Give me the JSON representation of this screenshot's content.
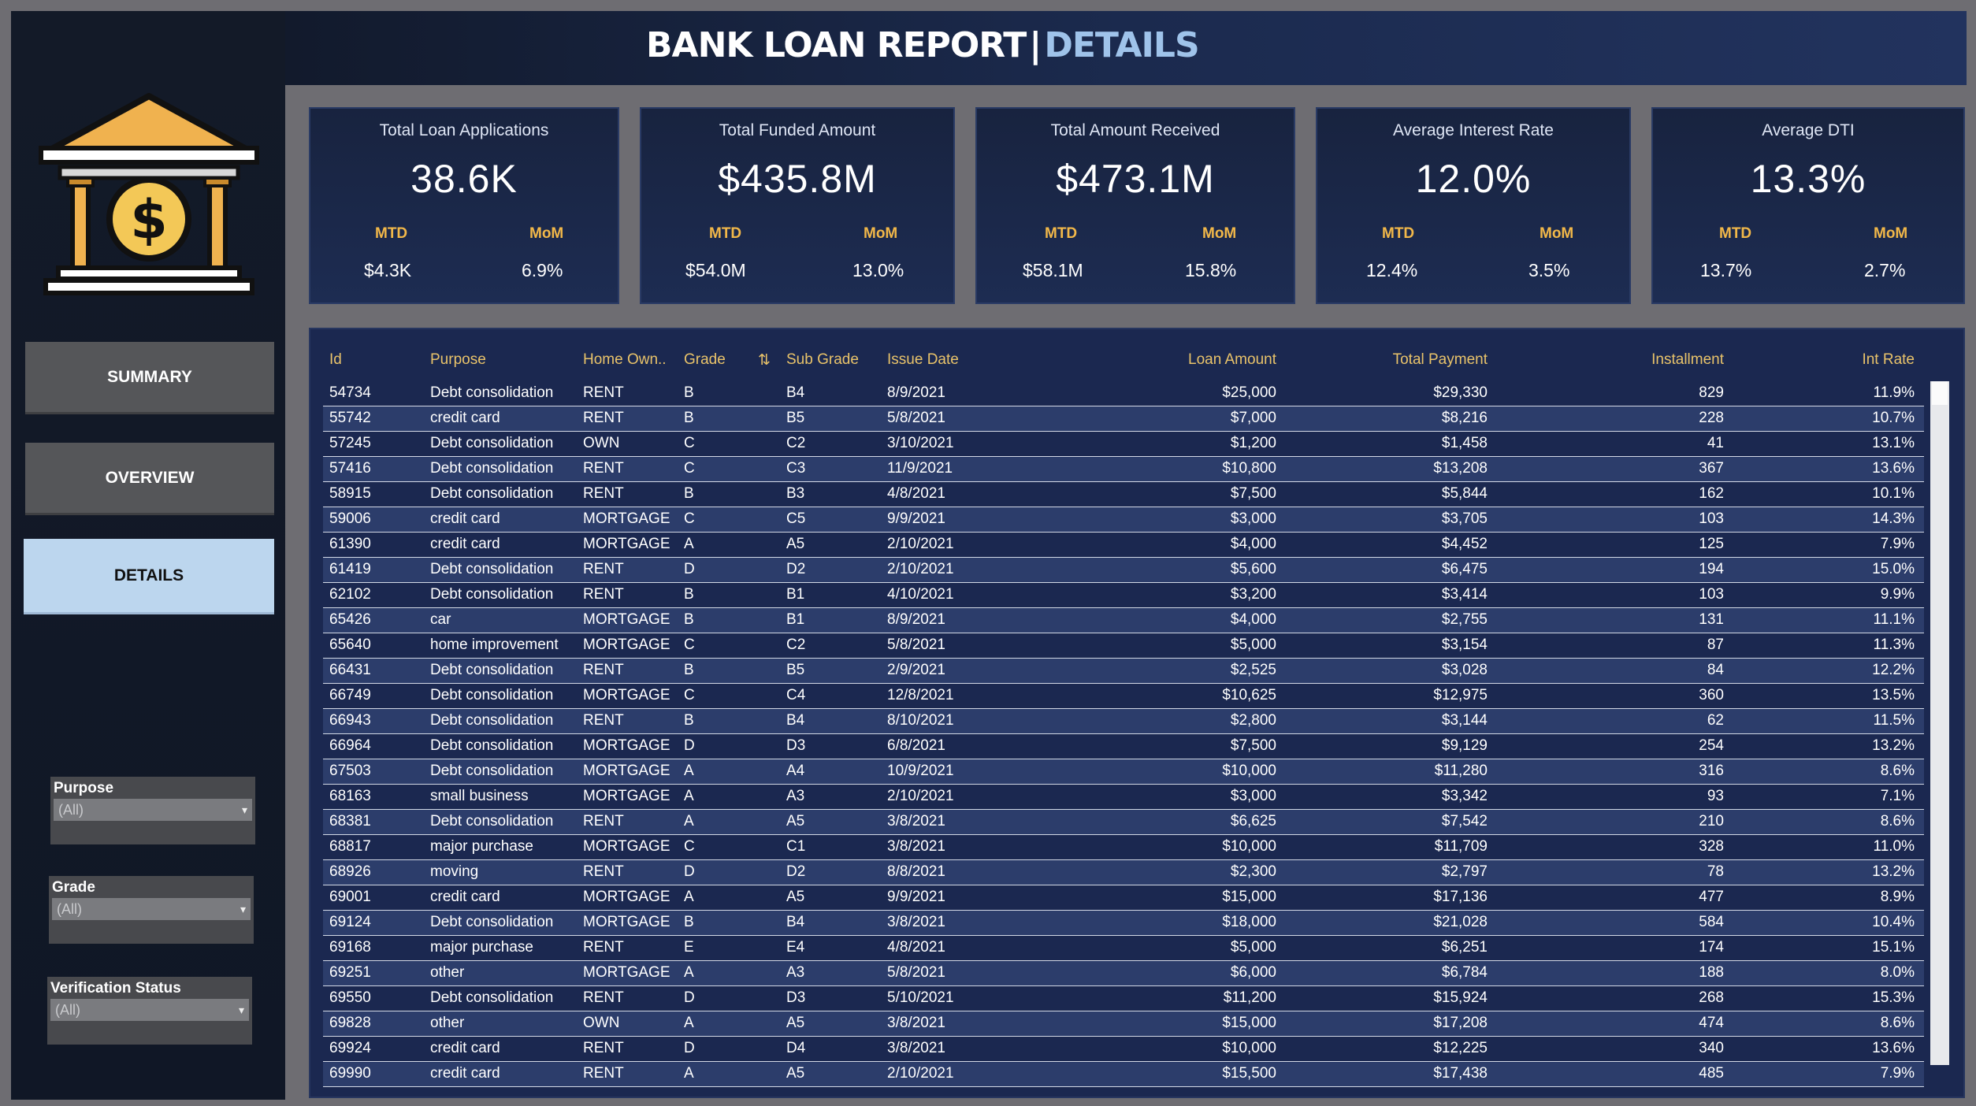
{
  "header": {
    "title_main": "BANK LOAN REPORT",
    "title_sep": "|",
    "title_section": "DETAILS"
  },
  "colors": {
    "accent_gold": "#f2b849",
    "nav_active": "#bcd6ee",
    "panel": "#1b2850"
  },
  "kpis": [
    {
      "title": "Total Loan Applications",
      "value": "38.6K",
      "mtd_label": "MTD",
      "mom_label": "MoM",
      "mtd": "$4.3K",
      "mom": "6.9%"
    },
    {
      "title": "Total Funded Amount",
      "value": "$435.8M",
      "mtd_label": "MTD",
      "mom_label": "MoM",
      "mtd": "$54.0M",
      "mom": "13.0%"
    },
    {
      "title": "Total Amount Received",
      "value": "$473.1M",
      "mtd_label": "MTD",
      "mom_label": "MoM",
      "mtd": "$58.1M",
      "mom": "15.8%"
    },
    {
      "title": "Average Interest Rate",
      "value": "12.0%",
      "mtd_label": "MTD",
      "mom_label": "MoM",
      "mtd": "12.4%",
      "mom": "3.5%"
    },
    {
      "title": "Average DTI",
      "value": "13.3%",
      "mtd_label": "MTD",
      "mom_label": "MoM",
      "mtd": "13.7%",
      "mom": "2.7%"
    }
  ],
  "nav": {
    "summary": "SUMMARY",
    "overview": "OVERVIEW",
    "details": "DETAILS"
  },
  "filters": [
    {
      "label": "Purpose",
      "value": "(All)"
    },
    {
      "label": "Grade",
      "value": "(All)"
    },
    {
      "label": "Verification Status",
      "value": "(All)"
    }
  ],
  "table": {
    "columns": [
      "Id",
      "Purpose",
      "Home Own..",
      "Grade",
      "Sub Grade",
      "Issue Date",
      "Loan Amount",
      "Total Payment",
      "Installment",
      "Int Rate"
    ],
    "rows": [
      [
        "54734",
        "Debt consolidation",
        "RENT",
        "B",
        "B4",
        "8/9/2021",
        "$25,000",
        "$29,330",
        "829",
        "11.9%"
      ],
      [
        "55742",
        "credit card",
        "RENT",
        "B",
        "B5",
        "5/8/2021",
        "$7,000",
        "$8,216",
        "228",
        "10.7%"
      ],
      [
        "57245",
        "Debt consolidation",
        "OWN",
        "C",
        "C2",
        "3/10/2021",
        "$1,200",
        "$1,458",
        "41",
        "13.1%"
      ],
      [
        "57416",
        "Debt consolidation",
        "RENT",
        "C",
        "C3",
        "11/9/2021",
        "$10,800",
        "$13,208",
        "367",
        "13.6%"
      ],
      [
        "58915",
        "Debt consolidation",
        "RENT",
        "B",
        "B3",
        "4/8/2021",
        "$7,500",
        "$5,844",
        "162",
        "10.1%"
      ],
      [
        "59006",
        "credit card",
        "MORTGAGE",
        "C",
        "C5",
        "9/9/2021",
        "$3,000",
        "$3,705",
        "103",
        "14.3%"
      ],
      [
        "61390",
        "credit card",
        "MORTGAGE",
        "A",
        "A5",
        "2/10/2021",
        "$4,000",
        "$4,452",
        "125",
        "7.9%"
      ],
      [
        "61419",
        "Debt consolidation",
        "RENT",
        "D",
        "D2",
        "2/10/2021",
        "$5,600",
        "$6,475",
        "194",
        "15.0%"
      ],
      [
        "62102",
        "Debt consolidation",
        "RENT",
        "B",
        "B1",
        "4/10/2021",
        "$3,200",
        "$3,414",
        "103",
        "9.9%"
      ],
      [
        "65426",
        "car",
        "MORTGAGE",
        "B",
        "B1",
        "8/9/2021",
        "$4,000",
        "$2,755",
        "131",
        "11.1%"
      ],
      [
        "65640",
        "home improvement",
        "MORTGAGE",
        "C",
        "C2",
        "5/8/2021",
        "$5,000",
        "$3,154",
        "87",
        "11.3%"
      ],
      [
        "66431",
        "Debt consolidation",
        "RENT",
        "B",
        "B5",
        "2/9/2021",
        "$2,525",
        "$3,028",
        "84",
        "12.2%"
      ],
      [
        "66749",
        "Debt consolidation",
        "MORTGAGE",
        "C",
        "C4",
        "12/8/2021",
        "$10,625",
        "$12,975",
        "360",
        "13.5%"
      ],
      [
        "66943",
        "Debt consolidation",
        "RENT",
        "B",
        "B4",
        "8/10/2021",
        "$2,800",
        "$3,144",
        "62",
        "11.5%"
      ],
      [
        "66964",
        "Debt consolidation",
        "MORTGAGE",
        "D",
        "D3",
        "6/8/2021",
        "$7,500",
        "$9,129",
        "254",
        "13.2%"
      ],
      [
        "67503",
        "Debt consolidation",
        "MORTGAGE",
        "A",
        "A4",
        "10/9/2021",
        "$10,000",
        "$11,280",
        "316",
        "8.6%"
      ],
      [
        "68163",
        "small business",
        "MORTGAGE",
        "A",
        "A3",
        "2/10/2021",
        "$3,000",
        "$3,342",
        "93",
        "7.1%"
      ],
      [
        "68381",
        "Debt consolidation",
        "RENT",
        "A",
        "A5",
        "3/8/2021",
        "$6,625",
        "$7,542",
        "210",
        "8.6%"
      ],
      [
        "68817",
        "major purchase",
        "MORTGAGE",
        "C",
        "C1",
        "3/8/2021",
        "$10,000",
        "$11,709",
        "328",
        "11.0%"
      ],
      [
        "68926",
        "moving",
        "RENT",
        "D",
        "D2",
        "8/8/2021",
        "$2,300",
        "$2,797",
        "78",
        "13.2%"
      ],
      [
        "69001",
        "credit card",
        "MORTGAGE",
        "A",
        "A5",
        "9/9/2021",
        "$15,000",
        "$17,136",
        "477",
        "8.9%"
      ],
      [
        "69124",
        "Debt consolidation",
        "MORTGAGE",
        "B",
        "B4",
        "3/8/2021",
        "$18,000",
        "$21,028",
        "584",
        "10.4%"
      ],
      [
        "69168",
        "major purchase",
        "RENT",
        "E",
        "E4",
        "4/8/2021",
        "$5,000",
        "$6,251",
        "174",
        "15.1%"
      ],
      [
        "69251",
        "other",
        "MORTGAGE",
        "A",
        "A3",
        "5/8/2021",
        "$6,000",
        "$6,784",
        "188",
        "8.0%"
      ],
      [
        "69550",
        "Debt consolidation",
        "RENT",
        "D",
        "D3",
        "5/10/2021",
        "$11,200",
        "$15,924",
        "268",
        "15.3%"
      ],
      [
        "69828",
        "other",
        "OWN",
        "A",
        "A5",
        "3/8/2021",
        "$15,000",
        "$17,208",
        "474",
        "8.6%"
      ],
      [
        "69924",
        "credit card",
        "RENT",
        "D",
        "D4",
        "3/8/2021",
        "$10,000",
        "$12,225",
        "340",
        "13.6%"
      ],
      [
        "69990",
        "credit card",
        "RENT",
        "A",
        "A5",
        "2/10/2021",
        "$15,500",
        "$17,438",
        "485",
        "7.9%"
      ]
    ]
  }
}
